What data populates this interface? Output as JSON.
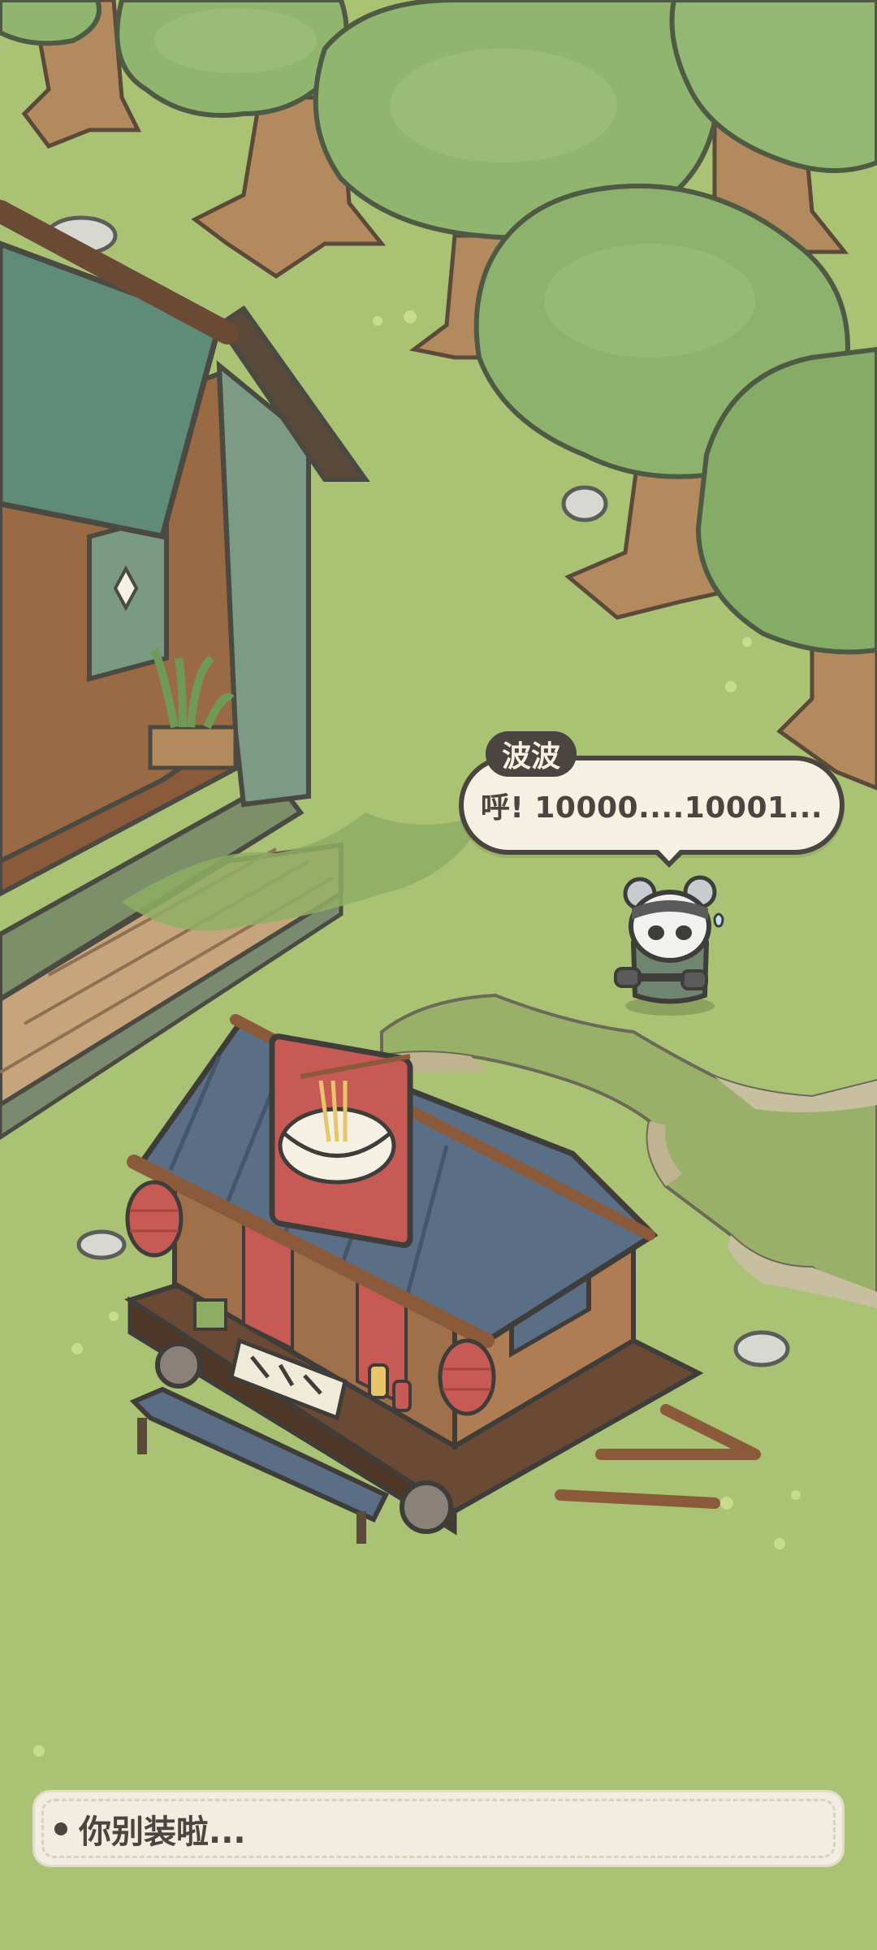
{
  "game": {
    "speaker_name": "波波",
    "speech_text": "呼! 10000....10001...",
    "dialog_text": "你别装啦..."
  },
  "colors": {
    "grass": "#a9c274",
    "tree_canopy": "#8fb56f",
    "tree_trunk": "#b38a5e",
    "roof_green": "#5f8c78",
    "roof_blue": "#5a6f86",
    "wood": "#8a5a3a",
    "text_dark": "#4a4540",
    "bubble_bg": "#f4f1e3"
  }
}
